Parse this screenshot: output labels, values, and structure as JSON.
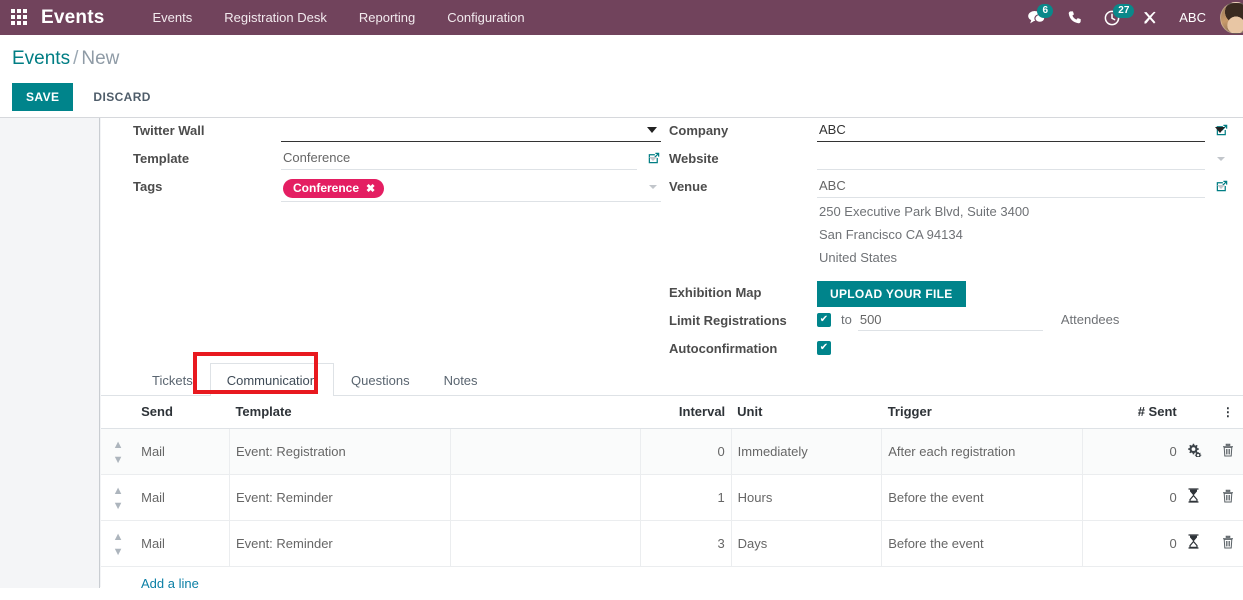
{
  "navbar": {
    "apps_icon": "apps-grid-icon",
    "brand": "Events",
    "menu": [
      {
        "label": "Events"
      },
      {
        "label": "Registration Desk"
      },
      {
        "label": "Reporting"
      },
      {
        "label": "Configuration"
      }
    ],
    "right": {
      "messages_icon": "chat-bubble-icon",
      "messages_count": "6",
      "phone_icon": "phone-icon",
      "activities_icon": "clock-icon",
      "activities_count": "27",
      "tools_icon": "wrench-screwdriver-icon",
      "user_name": "ABC",
      "avatar": "user-avatar"
    },
    "bg_color": "#71435c",
    "badge_color": "#0a888a"
  },
  "control_panel": {
    "breadcrumb_root": "Events",
    "breadcrumb_separator": "/",
    "breadcrumb_current": "New",
    "save_label": "SAVE",
    "discard_label": "DISCARD",
    "save_color": "#00848b"
  },
  "form": {
    "left": [
      {
        "label": "Twitter Wall",
        "value": "",
        "placeholder": "",
        "focused": true,
        "caret": "chevron-down-icon"
      },
      {
        "label": "Template",
        "value": "Conference",
        "placeholder": "",
        "focused": false,
        "caret": "chevron-down-icon",
        "external_link": "open-record-icon"
      },
      {
        "label": "Tags",
        "tag": "Conference",
        "tag_remove": "✖",
        "tag_color": "#e41e62",
        "caret": "chevron-down-icon"
      }
    ],
    "right": {
      "company": {
        "label": "Company",
        "value": "ABC",
        "focused": true,
        "external_link": "open-record-icon"
      },
      "website": {
        "label": "Website",
        "value": "",
        "focused": false
      },
      "venue": {
        "label": "Venue",
        "value": "ABC",
        "external_link": "open-record-icon",
        "address": [
          "250 Executive Park Blvd, Suite 3400",
          "San Francisco CA 94134",
          "United States"
        ]
      },
      "exhibition_map": {
        "label": "Exhibition Map",
        "button": "UPLOAD YOUR FILE"
      },
      "limit_registrations": {
        "label": "Limit Registrations",
        "checked": true,
        "check_glyph": "✔",
        "prefix": "to",
        "value": "500",
        "suffix": "Attendees"
      },
      "autoconfirmation": {
        "label": "Autoconfirmation",
        "checked": true,
        "check_glyph": "✔"
      }
    }
  },
  "notebook": {
    "tabs": [
      {
        "label": "Tickets",
        "active": false
      },
      {
        "label": "Communication",
        "active": true
      },
      {
        "label": "Questions",
        "active": false
      },
      {
        "label": "Notes",
        "active": false
      }
    ],
    "highlight_color": "#e8191f",
    "highlighted_tab": "Communication"
  },
  "line_table": {
    "columns": [
      "Send",
      "Template",
      "Interval",
      "Unit",
      "Trigger",
      "# Sent"
    ],
    "options_icon": "kebab-menu-icon",
    "handle_icon": "drag-handle-icon",
    "delete_icon": "trash-icon",
    "rows": [
      {
        "send": "Mail",
        "template": "Event: Registration",
        "interval": "0",
        "unit": "Immediately",
        "trigger": "After each registration",
        "sent": "0",
        "status_icon": "cogs-icon",
        "status_glyph": "⚙"
      },
      {
        "send": "Mail",
        "template": "Event: Reminder",
        "interval": "1",
        "unit": "Hours",
        "trigger": "Before the event",
        "sent": "0",
        "status_icon": "hourglass-icon",
        "status_glyph": "⧖"
      },
      {
        "send": "Mail",
        "template": "Event: Reminder",
        "interval": "3",
        "unit": "Days",
        "trigger": "Before the event",
        "sent": "0",
        "status_icon": "hourglass-icon",
        "status_glyph": "⧖"
      }
    ],
    "add_line_label": "Add a line"
  }
}
